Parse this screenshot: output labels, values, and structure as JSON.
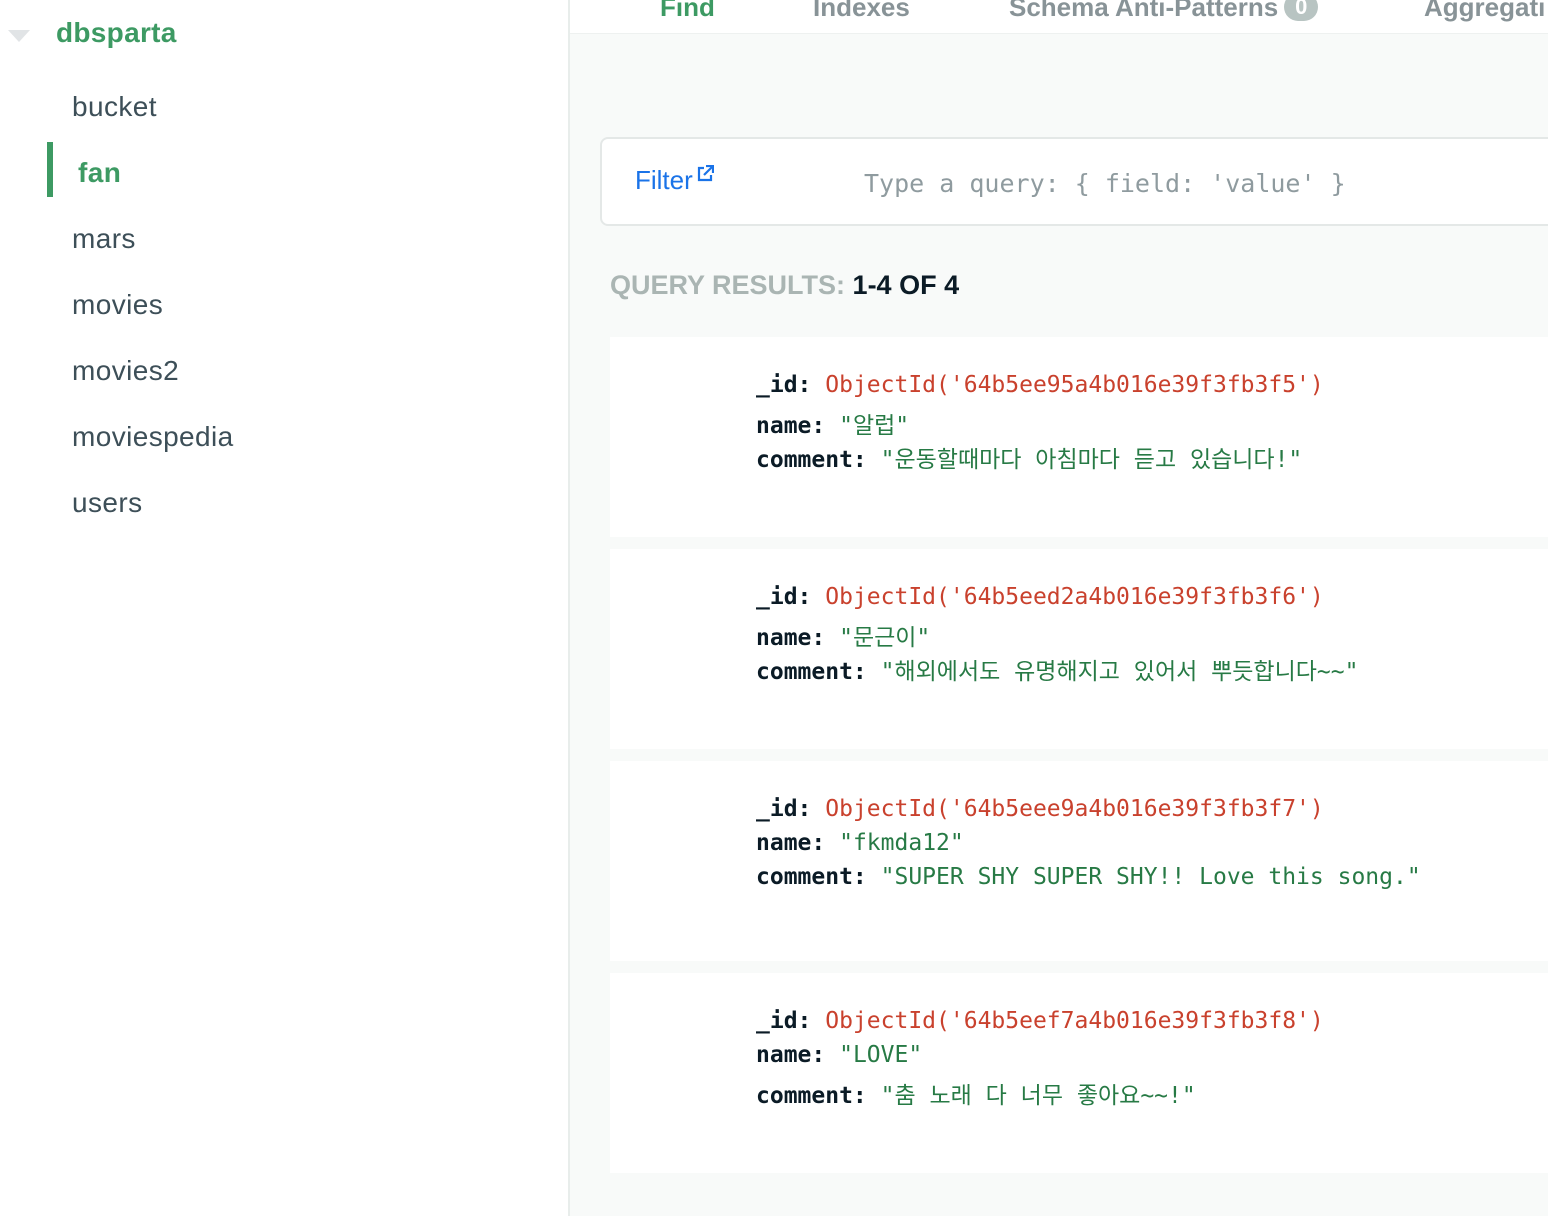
{
  "sidebar": {
    "database": "dbsparta",
    "collections": [
      {
        "label": "bucket",
        "active": false
      },
      {
        "label": "fan",
        "active": true
      },
      {
        "label": "mars",
        "active": false
      },
      {
        "label": "movies",
        "active": false
      },
      {
        "label": "movies2",
        "active": false
      },
      {
        "label": "moviespedia",
        "active": false
      },
      {
        "label": "users",
        "active": false
      }
    ]
  },
  "tabs": [
    {
      "label": "Find",
      "active": true
    },
    {
      "label": "Indexes",
      "active": false
    },
    {
      "label": "Schema Anti-Patterns",
      "badge": "0",
      "active": false
    },
    {
      "label": "Aggregati",
      "active": false
    }
  ],
  "filter": {
    "label": "Filter",
    "placeholder": "Type a query: { field: 'value' }",
    "icon": "external-link-icon"
  },
  "results": {
    "label": "QUERY RESULTS:",
    "range": "1-4 OF 4"
  },
  "documents": [
    {
      "id_key": "_id:",
      "id": "ObjectId('64b5ee95a4b016e39f3fb3f5')",
      "name_key": "name:",
      "name": "\"알럽\"",
      "comment_key": "comment:",
      "comment": "\"운동할때마다 아침마다 듣고 있습니다!\""
    },
    {
      "id_key": "_id:",
      "id": "ObjectId('64b5eed2a4b016e39f3fb3f6')",
      "name_key": "name:",
      "name": "\"문근이\"",
      "comment_key": "comment:",
      "comment": "\"해외에서도 유명해지고 있어서 뿌듯합니다~~\""
    },
    {
      "id_key": "_id:",
      "id": "ObjectId('64b5eee9a4b016e39f3fb3f7')",
      "name_key": "name:",
      "name": "\"fkmda12\"",
      "comment_key": "comment:",
      "comment": "\"SUPER SHY SUPER SHY!! Love this song.\""
    },
    {
      "id_key": "_id:",
      "id": "ObjectId('64b5eef7a4b016e39f3fb3f8')",
      "name_key": "name:",
      "name": "\"LOVE\"",
      "comment_key": "comment:",
      "comment": "\"춤 노래 다 너무 좋아요~~!\""
    }
  ],
  "colors": {
    "accent_green": "#3d9a63",
    "link_blue": "#1a73e8",
    "objectid_red": "#c9412d",
    "string_green": "#277a45"
  }
}
